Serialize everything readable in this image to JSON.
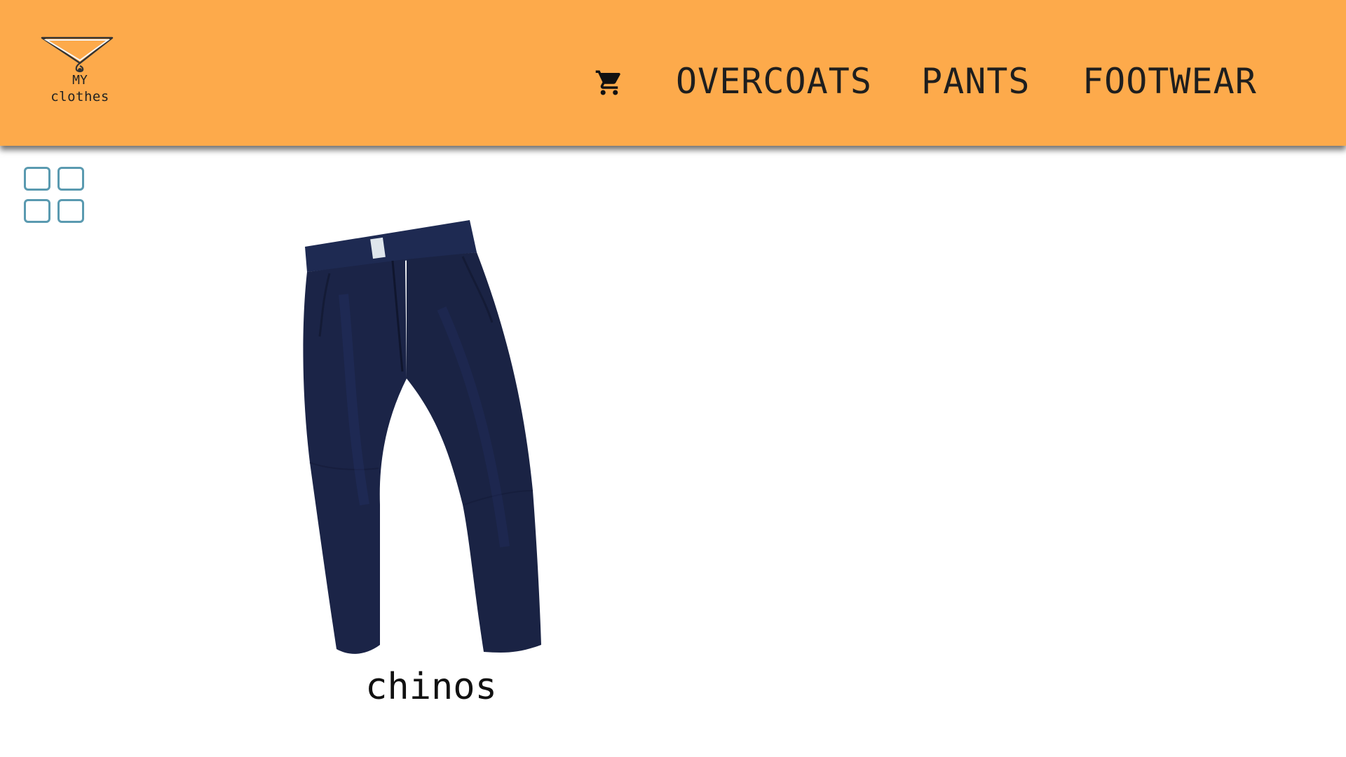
{
  "header": {
    "logo": {
      "line1": "MY",
      "line2": "clothes"
    },
    "cart": {
      "icon": "shopping-cart-icon"
    },
    "nav": [
      {
        "label": "OVERCOATS"
      },
      {
        "label": "PANTS"
      },
      {
        "label": "FOOTWEAR"
      }
    ],
    "background_color": "#FDAA4B"
  },
  "view_toggle": {
    "icon": "grid-view-icon",
    "color": "#5A9AB0"
  },
  "products": [
    {
      "name": "chinos",
      "image": "navy-pants-image",
      "color": "#1B2447"
    }
  ]
}
